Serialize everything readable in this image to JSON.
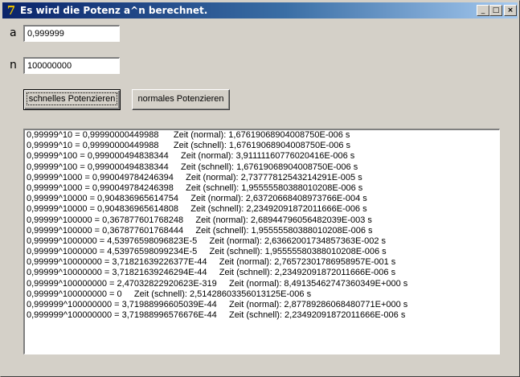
{
  "window": {
    "title": "Es wird die Potenz a^n berechnet.",
    "controls": {
      "minimize": "_",
      "maximize": "□",
      "close": "×"
    }
  },
  "inputs": {
    "a_label": "a",
    "a_value": "0,999999",
    "n_label": "n",
    "n_value": "100000000"
  },
  "buttons": {
    "fast": "schnelles Potenzieren",
    "normal": "normales Potenzieren"
  },
  "output_lines": [
    "0,99999^10 = 0,99990000449988      Zeit (normal): 1,67619068904008750E-006 s",
    "0,99999^10 = 0,99990000449988      Zeit (schnell): 1,67619068904008750E-006 s",
    "0,99999^100 = 0,99900049483834­4     Zeit (normal): 3,91111160776020416E-006 s",
    "0,99999^100 = 0,999000494838344     Zeit (schnell): 1,67619068904008750E-006 s",
    "0,99999^1000 = 0,990049784246394     Zeit (normal): 2,73777812543214291E-005 s",
    "0,99999^1000 = 0,990049784246398     Zeit (schnell): 1,95555580388010208E-006 s",
    "0,99999^10000 = 0,904836965614754     Zeit (normal): 2,63720668408973766E-004 s",
    "0,99999^10000 = 0,904836965614808     Zeit (schnell): 2,23492091872011666E-006 s",
    "0,99999^100000 = 0,367877601768248     Zeit (normal): 2,68944796056482039E-003 s",
    "0,99999^100000 = 0,367877601768444     Zeit (schnell): 1,95555580388010208E-006 s",
    "0,99999^1000000 = 4,53976598096823E-5     Zeit (normal): 2,63662001734857363E-002 s",
    "0,99999^1000000 = 4,53976598099234E-5     Zeit (schnell): 1,95555580388010208E-006 s",
    "0,99999^10000000 = 3,71821639226377E-44     Zeit (normal): 2,76572301786958957E-001 s",
    "0,99999^10000000 = 3,71821639246294E-44     Zeit (schnell): 2,23492091872011666E-006 s",
    "0,99999^100000000 = 2,47032822920623E-319     Zeit (normal): 8,49135462747360349E+000 s",
    "0,99999^100000000 = 0     Zeit (schnell): 2,51428603356013125E-006 s",
    "0,999999^100000000 = 3,71988996605039E-44     Zeit (normal): 2,87789286068480771E+000 s",
    "0,999999^100000000 = 3,71988996576676E-44     Zeit (schnell): 2,23492091872011666E-006 s"
  ]
}
